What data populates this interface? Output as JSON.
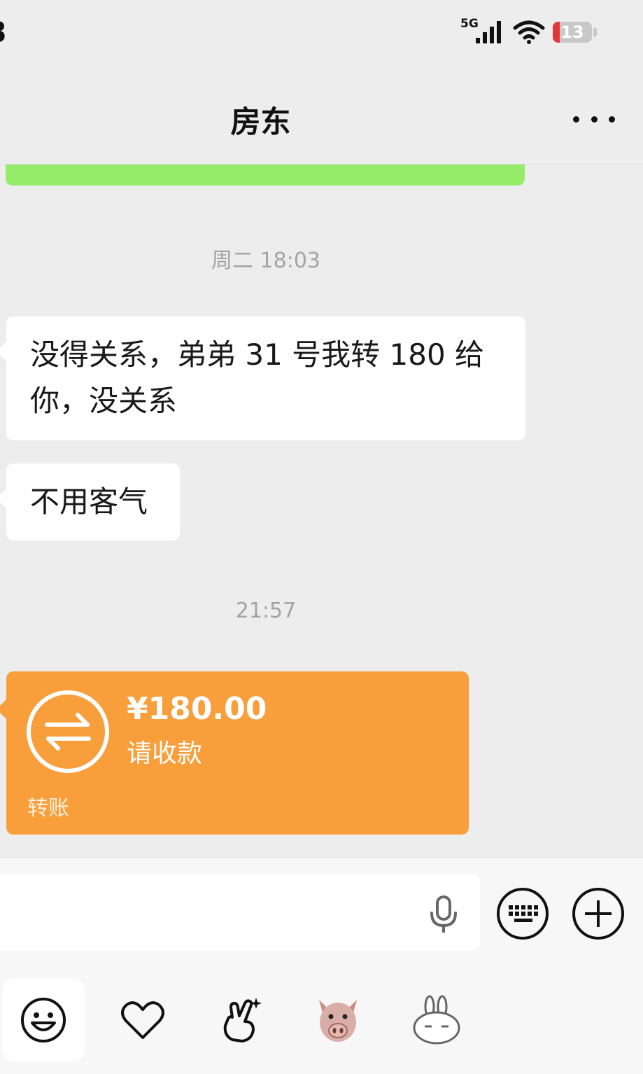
{
  "status_bar": {
    "time_fragment": "3",
    "network": "5G",
    "battery_level": "13",
    "battery_color": "#e5343b"
  },
  "header": {
    "title": "房东",
    "more_icon": "more-dots-icon"
  },
  "messages": [
    {
      "type": "timestamp",
      "text": "周二 18:03"
    },
    {
      "type": "text",
      "sender": "contact",
      "line1": "没得关系，弟弟 31 号我转 180 给",
      "line2": "你，没关系"
    },
    {
      "type": "text",
      "sender": "contact",
      "text": "不用客气"
    },
    {
      "type": "timestamp",
      "text": "21:57"
    },
    {
      "type": "transfer",
      "sender": "contact",
      "amount": "¥180.00",
      "status": "请收款",
      "label": "转账",
      "color": "#f89e3b"
    }
  ],
  "own_bubble_color": "#95ec69",
  "input_bar": {
    "placeholder": "",
    "voice_icon": "microphone-icon",
    "keyboard_icon": "keyboard-icon",
    "plus_icon": "plus-icon"
  },
  "emoji_tabs": [
    {
      "icon": "smiley-face-icon",
      "active": true
    },
    {
      "icon": "heart-icon",
      "active": false
    },
    {
      "icon": "victory-hand-icon",
      "active": false
    },
    {
      "icon": "pig-sticker-icon",
      "active": false
    },
    {
      "icon": "rabbit-sticker-icon",
      "active": false
    }
  ]
}
